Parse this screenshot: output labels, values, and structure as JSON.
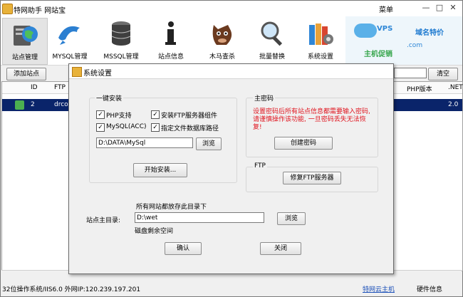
{
  "app": {
    "title": "特网助手 网站宝",
    "menu_label": "菜单"
  },
  "window_controls": {
    "minimize": "—",
    "maximize": "□",
    "close": "✕"
  },
  "toolbar": [
    {
      "label": "站点管理",
      "icon": "globe-server-icon"
    },
    {
      "label": "MYSQL管理",
      "icon": "mysql-dolphin-icon"
    },
    {
      "label": "MSSQL管理",
      "icon": "database-icon"
    },
    {
      "label": "站点信息",
      "icon": "info-icon"
    },
    {
      "label": "木马查杀",
      "icon": "trojan-horse-icon"
    },
    {
      "label": "批量替换",
      "icon": "magnifier-icon"
    },
    {
      "label": "系统设置",
      "icon": "settings-books-icon"
    }
  ],
  "banner": {
    "vps": "VPS",
    "domain": "域名特价",
    "host": "主机促销",
    "com": ".com"
  },
  "subbar": {
    "add_site": "添加站点",
    "clear": "清空"
  },
  "table": {
    "headers": {
      "id": "ID",
      "ftp": "FTP",
      "php": "PHP版本",
      "net": ".NET"
    },
    "row": {
      "id": "2",
      "ftp": "drcom",
      "php": "",
      "net": "2.0"
    }
  },
  "statusbar": {
    "left": "32位操作系统/IIS6.0 外网IP:120.239.197.201",
    "link": "特网云主机",
    "info": "硬件信息"
  },
  "dialog": {
    "title": "系统设置",
    "install_group": "一键安装",
    "checks": [
      {
        "label": "PHP支持",
        "checked": true
      },
      {
        "label": "安装FTP服务器组件",
        "checked": true
      },
      {
        "label": "MySQL(ACC)",
        "checked": true
      },
      {
        "label": "指定文件数据库路径",
        "checked": true
      }
    ],
    "path_value": "D:\\DATA\\MySql",
    "browse_label": "浏览",
    "start_install": "开始安装...",
    "password_group": "主密码",
    "password_warning": "设置密码后所有站点信息都需要输入密码, 请谨慎操作该功能, 一旦密码丢失无法恢复!",
    "create_password": "创建密码",
    "ftp_group": "FTP",
    "repair_ftp": "修复FTP服务器",
    "site_root_label": "站点主目录:",
    "site_root_hint": "所有网站都放存此目录下",
    "site_root_value": "D:\\wet",
    "site_root_browse": "浏览",
    "disk_free": "磁盘剩余空间",
    "ok": "确认",
    "close": "关闭"
  }
}
